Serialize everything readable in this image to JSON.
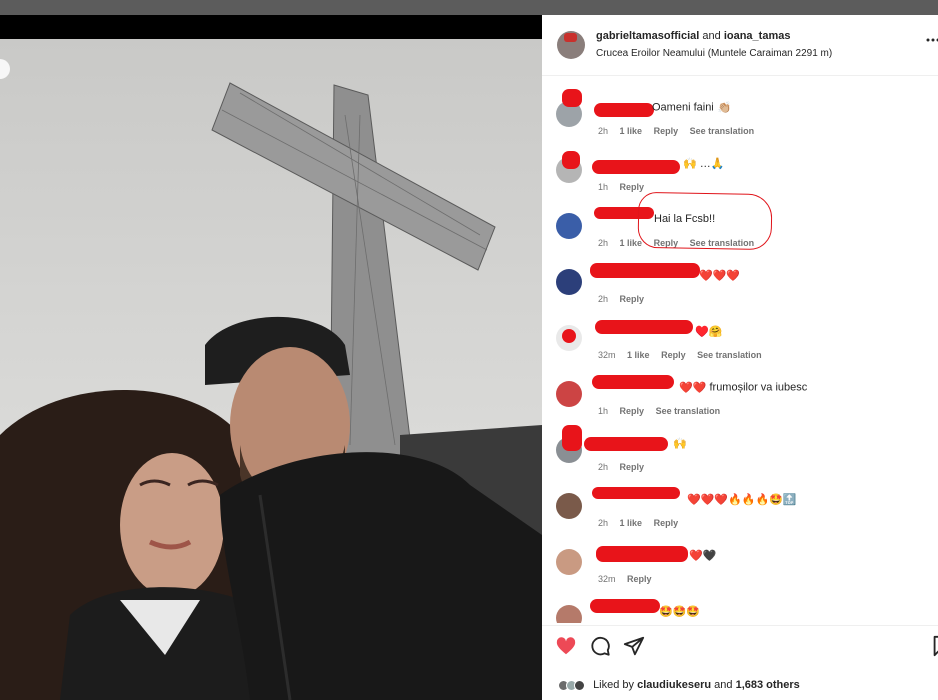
{
  "post": {
    "author": "gabrieltamasofficial",
    "conjunction": "and",
    "coauthor": "ioana_tamas",
    "location": "Crucea Eroilor Neamului (Muntele Caraiman 2291 m)"
  },
  "comments": [
    {
      "text": "Oameni faini",
      "emoji": "👏🏼",
      "time": "2h",
      "likes": "1 like",
      "reply": "Reply",
      "translate": "See translation"
    },
    {
      "text": "",
      "emoji": "🙌 …🙏",
      "time": "1h",
      "likes": "",
      "reply": "Reply",
      "translate": ""
    },
    {
      "text": "Hai la Fcsb!!",
      "emoji": "",
      "time": "2h",
      "likes": "1 like",
      "reply": "Reply",
      "translate": "See translation"
    },
    {
      "text": "",
      "emoji": "❤️❤️❤️",
      "time": "2h",
      "likes": "",
      "reply": "Reply",
      "translate": ""
    },
    {
      "text": "",
      "emoji": "♥️🤗",
      "time": "32m",
      "likes": "1 like",
      "reply": "Reply",
      "translate": "See translation"
    },
    {
      "text": "frumoșilor va iubesc",
      "emoji": "❤️❤️",
      "time": "1h",
      "likes": "",
      "reply": "Reply",
      "translate": "See translation"
    },
    {
      "text": "",
      "emoji": "🙌",
      "time": "2h",
      "likes": "",
      "reply": "Reply",
      "translate": ""
    },
    {
      "text": "",
      "emoji": "❤️❤️❤️🔥🔥🔥🤩🔝",
      "time": "2h",
      "likes": "1 like",
      "reply": "Reply",
      "translate": ""
    },
    {
      "text": "",
      "emoji": "❤️🖤",
      "time": "32m",
      "likes": "",
      "reply": "Reply",
      "translate": ""
    },
    {
      "text": "",
      "emoji": "🤩🤩🤩",
      "time": "",
      "likes": "",
      "reply": "",
      "translate": ""
    }
  ],
  "actions": {
    "like_icon": "heart-icon",
    "comment_icon": "comment-icon",
    "share_icon": "share-icon",
    "save_icon": "bookmark-icon"
  },
  "likes": {
    "prefix": "Liked by",
    "user": "claudiukeseru",
    "suffix": "and",
    "others": "1,683 others"
  },
  "colors": {
    "redaction": "#e8141a",
    "like_heart": "#ed4956",
    "annotation": "#e0141a"
  }
}
